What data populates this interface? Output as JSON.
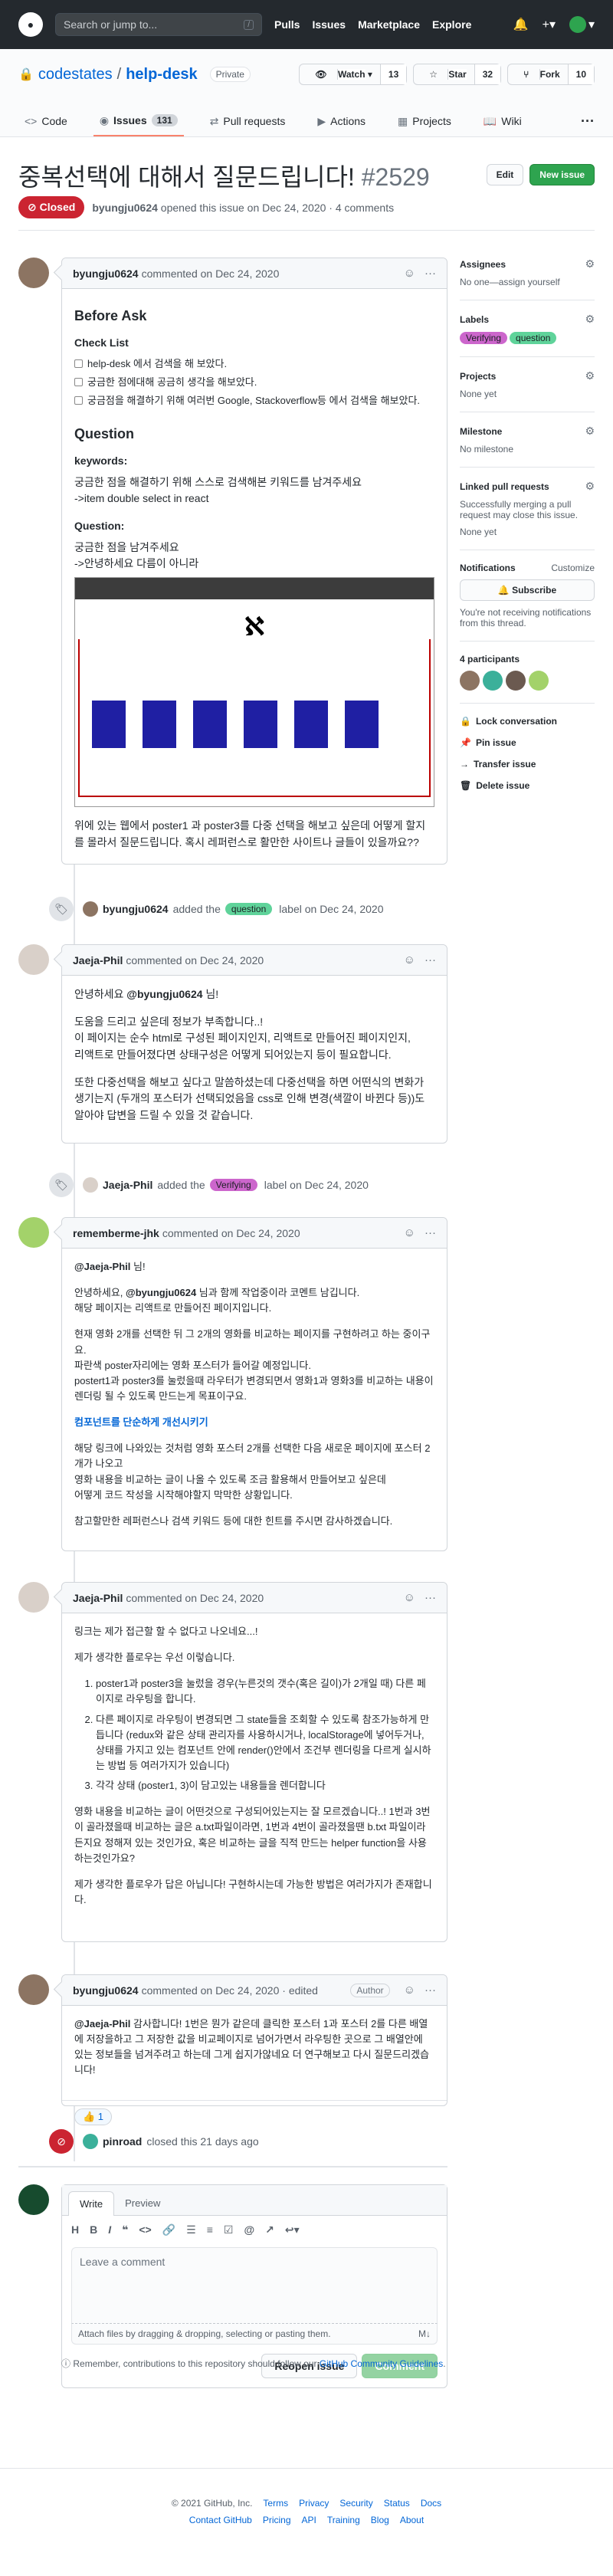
{
  "header": {
    "search_placeholder": "Search or jump to...",
    "search_key": "/",
    "nav": [
      "Pulls",
      "Issues",
      "Marketplace",
      "Explore"
    ]
  },
  "repo": {
    "owner": "codestates",
    "name": "help-desk",
    "visibility": "Private",
    "watch": {
      "label": "Watch",
      "count": "13"
    },
    "star": {
      "label": "Star",
      "count": "32"
    },
    "fork": {
      "label": "Fork",
      "count": "10"
    }
  },
  "tabs": [
    {
      "label": "Code"
    },
    {
      "label": "Issues",
      "count": "131"
    },
    {
      "label": "Pull requests"
    },
    {
      "label": "Actions"
    },
    {
      "label": "Projects"
    },
    {
      "label": "Wiki"
    }
  ],
  "issue": {
    "title": "중복선택에 대해서 질문드립니다!",
    "number": "#2529",
    "edit_label": "Edit",
    "new_label": "New issue",
    "state": "Closed",
    "author": "byungju0624",
    "meta": "opened this issue on Dec 24, 2020 · 4 comments"
  },
  "comments": [
    {
      "author": "byungju0624",
      "meta": "commented on Dec 24, 2020",
      "h_before": "Before Ask",
      "h_check": "Check List",
      "checks": [
        "help-desk 에서 검색을 해 보았다.",
        "궁금한 점에대해 공금히 생각을 해보았다.",
        "궁금점을 해결하기 위해 여러번 Google, Stackoverflow등 에서 검색을 해보았다."
      ],
      "h_question": "Question",
      "h_keywords": "keywords:",
      "p_keywords1": "궁금한 점을 해결하기 위해 스스로 검색해본 키워드를 남겨주세요",
      "p_keywords2": "->item double select in react",
      "h_q2": "Question:",
      "p_q1": "궁금한 점을 남겨주세요",
      "p_q2": "->안녕하세요 다름이 아니라",
      "p_tail": "위에 있는 웹에서 poster1 과 poster3를 다중 선택을 해보고 싶은데 어떻게 할지를 몰라서 질문드립니다. 혹시 레퍼런스로 활만한 사이트나 글들이 있을까요??"
    },
    {
      "author": "Jaeja-Phil",
      "meta": "commented on Dec 24, 2020",
      "p1a": "안녕하세요 ",
      "p1m": "@byungju0624",
      "p1b": " 님!",
      "p2": "도움을 드리고 싶은데 정보가 부족합니다..!\n이 페이지는 순수 html로 구성된 페이지인지, 리액트로 만들어진 페이지인지,\n리액트로 만들어졌다면 상태구성은 어떻게 되어있는지 등이 필요합니다.",
      "p3": "또한 다중선택을 해보고 싶다고 말씀하셨는데 다중선택을 하면 어떤식의 변화가 생기는지 (두개의 포스터가 선택되었음을 css로 인해 변경(색깔이 바뀐다 등))도 알아야 답변을 드릴 수 있을 것 같습니다."
    },
    {
      "author": "rememberme-jhk",
      "meta": "commented on Dec 24, 2020",
      "p1m": "@Jaeja-Phil",
      "p1b": " 님!",
      "p2a": "안녕하세요, ",
      "p2m": "@byungju0624",
      "p2b": " 님과 함께 작업중이라 코멘트 남깁니다.\n해당 페이지는 리액트로 만들어진 페이지입니다.",
      "p3": "현재 영화 2개를 선택한 뒤 그 2개의 영화를 비교하는 페이지를 구현하려고 하는 중이구요.\n파란색 poster자리에는 영화 포스터가 들어갈 예정입니다.\npostert1과 poster3를 눌렀을때 라우터가 변경되면서 영화1과 영화3를 비교하는 내용이 렌더링 될 수 있도록 만드는게 목표이구요.",
      "link": "컴포넌트를 단순하게 개선시키기",
      "p4": "해당 링크에 나와있는 것처럼 영화 포스터 2개를 선택한 다음 새로운 페이지에 포스터 2개가 나오고\n영화 내용을 비교하는 글이 나올 수 있도록 조금 활용해서 만들어보고 싶은데\n어떻게 코드 작성을 시작해야할지 막막한 상황입니다.",
      "p5": "참고할만한 레퍼런스나 검색 키워드 등에 대한 힌트를 주시면 감사하겠습니다."
    },
    {
      "author": "Jaeja-Phil",
      "meta": "commented on Dec 24, 2020",
      "p1": "링크는 제가 접근할 할 수 없다고 나오네요...!",
      "p2": "제가 생각한 플로우는 우선 이렇습니다.",
      "items": [
        "poster1과 poster3을 눌렀을 경우(누른것의 갯수(혹은 길이)가 2개일 때) 다른 페이지로 라우팅을 합니다.",
        "다른 페이지로 라우팅이 변경되면 그 state들을 조회할 수 있도록 참조가능하게 만듭니다 (redux와 같은 상태 관리자를 사용하시거나, localStorage에 넣어두거나, 상태를 가지고 있는 컴포넌트 안에 render()안에서 조건부 렌더링을 다르게 실시하는 방법 등 여러가지가 있습니다)",
        "각각 상태 (poster1, 3)이 담고있는 내용들을 렌더합니다"
      ],
      "p3": "영화 내용을 비교하는 글이 어떤것으로 구성되어있는지는 잘 모르겠습니다..! 1번과 3번이 골라졌을때 비교하는 글은 a.txt파일이라면, 1번과 4번이 골라졌을땐 b.txt 파일이라든지요 정해져 있는 것인가요, 혹은 비교하는 글을 직적 만드는 helper function을 사용하는것인가요?",
      "p4": "제가 생각한 플로우가 답은 아닙니다! 구현하시는데 가능한 방법은 여러가지가 존재합니다."
    },
    {
      "author": "byungju0624",
      "meta": "commented on Dec 24, 2020 · edited",
      "role": "Author",
      "p1m": "@Jaeja-Phil",
      "p1b": " 감사합니다! 1번은 뭔가 같은데 클릭한 포스터 1과 포스터 2를 다른 배열에 저장을하고 그 저장한 값을 비교페이지로 넘어가면서 라우팅한 곳으로 그 배열안에 있는 정보들을 넘겨주려고 하는데 그게 쉽지가않네요 더 연구해보고 다시 질문드리겠습니다!",
      "reaction": "👍 1"
    }
  ],
  "events": [
    {
      "actor": "byungju0624",
      "pre": "added the",
      "label": "question",
      "post": "label on Dec 24, 2020"
    },
    {
      "actor": "Jaeja-Phil",
      "pre": "added the",
      "label": "Verifying",
      "post": "label on Dec 24, 2020"
    },
    {
      "actor": "pinroad",
      "text": "closed this 21 days ago"
    }
  ],
  "sidebar": {
    "assignees_t": "Assignees",
    "assignees_v": "No one—assign yourself",
    "labels_t": "Labels",
    "labels": [
      "Verifying",
      "question"
    ],
    "projects_t": "Projects",
    "projects_v": "None yet",
    "milestone_t": "Milestone",
    "milestone_v": "No milestone",
    "linked_t": "Linked pull requests",
    "linked_d": "Successfully merging a pull request may close this issue.",
    "linked_v": "None yet",
    "notif_t": "Notifications",
    "notif_c": "Customize",
    "subscribe": "Subscribe",
    "notif_d": "You're not receiving notifications from this thread.",
    "participants": "4 participants",
    "actions": [
      "Lock conversation",
      "Pin issue",
      "Transfer issue",
      "Delete issue"
    ]
  },
  "editor": {
    "tabs": [
      "Write",
      "Preview"
    ],
    "placeholder": "Leave a comment",
    "hint": "Attach files by dragging & dropping, selecting or pasting them.",
    "reopen": "Reopen issue",
    "comment": "Comment",
    "note_pre": "Remember, contributions to this repository should follow our ",
    "note_link": "GitHub Community Guidelines",
    "note_post": "."
  },
  "footer": {
    "copy": "© 2021 GitHub, Inc.",
    "row1": [
      "Terms",
      "Privacy",
      "Security",
      "Status",
      "Docs"
    ],
    "row2": [
      "Contact GitHub",
      "Pricing",
      "API",
      "Training",
      "Blog",
      "About"
    ]
  },
  "colors": {
    "closed": "#cb2431",
    "green": "#2ea44f",
    "verifying": "#cc66cc",
    "question": "#5fd39a"
  }
}
